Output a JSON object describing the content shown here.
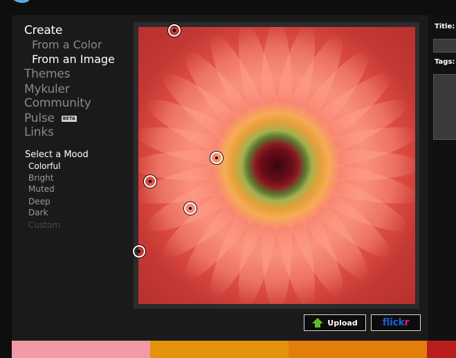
{
  "nav": {
    "create": "Create",
    "from_color": "From a Color",
    "from_image": "From an Image",
    "themes": "Themes",
    "mykuler": "Mykuler",
    "community": "Community",
    "pulse": "Pulse",
    "pulse_badge": "BETA",
    "links": "Links"
  },
  "mood": {
    "title": "Select a Mood",
    "items": [
      "Colorful",
      "Bright",
      "Muted",
      "Deep",
      "Dark",
      "Custom"
    ],
    "selected": "Colorful"
  },
  "buttons": {
    "upload": "Upload",
    "flickr_main": "flick",
    "flickr_r": "r"
  },
  "form": {
    "title_label": "Title:",
    "tags_label": "Tags:"
  },
  "palette": {
    "colors": [
      "#f29aa8",
      "#e2930b",
      "#e27f0a",
      "#b81e1e"
    ]
  },
  "colors": {
    "upload_arrow": "#5cbd2a",
    "flickr_blue": "#1b5fd6",
    "flickr_pink": "#e0197d"
  }
}
